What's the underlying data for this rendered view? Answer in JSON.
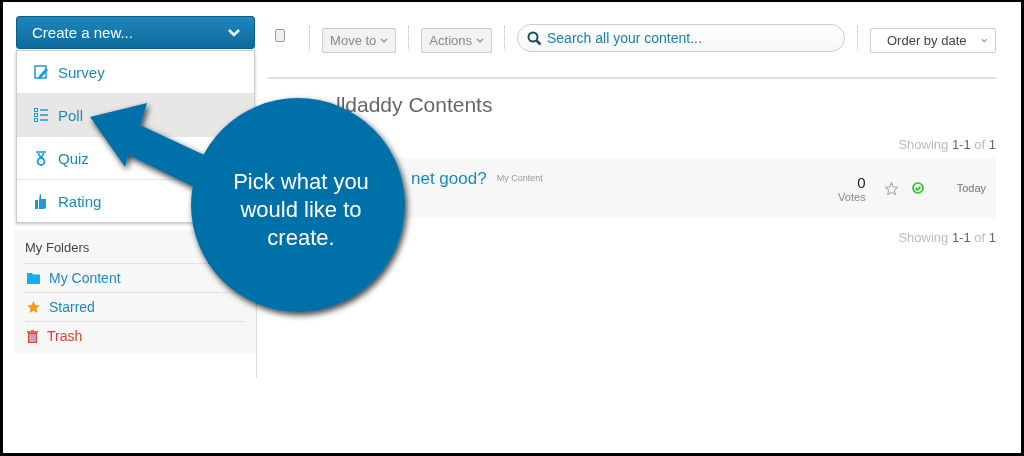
{
  "create_button": {
    "label": "Create a new...",
    "expanded": true
  },
  "create_menu": [
    {
      "kind": "survey",
      "label": "Survey",
      "selected": false
    },
    {
      "kind": "poll",
      "label": "Poll",
      "selected": true
    },
    {
      "kind": "quiz",
      "label": "Quiz",
      "selected": false
    },
    {
      "kind": "rating",
      "label": "Rating",
      "selected": false
    }
  ],
  "folders": {
    "title": "My Folders",
    "items": [
      {
        "kind": "folder",
        "label": "My Content",
        "color": "#1a8ac0"
      },
      {
        "kind": "star",
        "label": "Starred",
        "color": "#1a8ac0"
      },
      {
        "kind": "trash",
        "label": "Trash",
        "color": "#d9412b"
      }
    ]
  },
  "toolbar": {
    "select_all_checked": false,
    "move_to": "Move to",
    "actions": "Actions",
    "search": {
      "placeholder": "Search all your content..."
    },
    "order": "Order by date"
  },
  "title": "lldaddy Contents",
  "showing_top": {
    "prefix": "Showing",
    "range": "1-1",
    "of": "of",
    "total": "1"
  },
  "rows": [
    {
      "title": "net good?",
      "folder": "My Content",
      "votes": "0",
      "votes_label": "Votes",
      "starred": false,
      "published": true,
      "date": "Today"
    }
  ],
  "showing_bottom": {
    "prefix": "Showing",
    "range": "1-1",
    "of": "of",
    "total": "1"
  },
  "callout": {
    "text": "Pick what you would like to create."
  }
}
